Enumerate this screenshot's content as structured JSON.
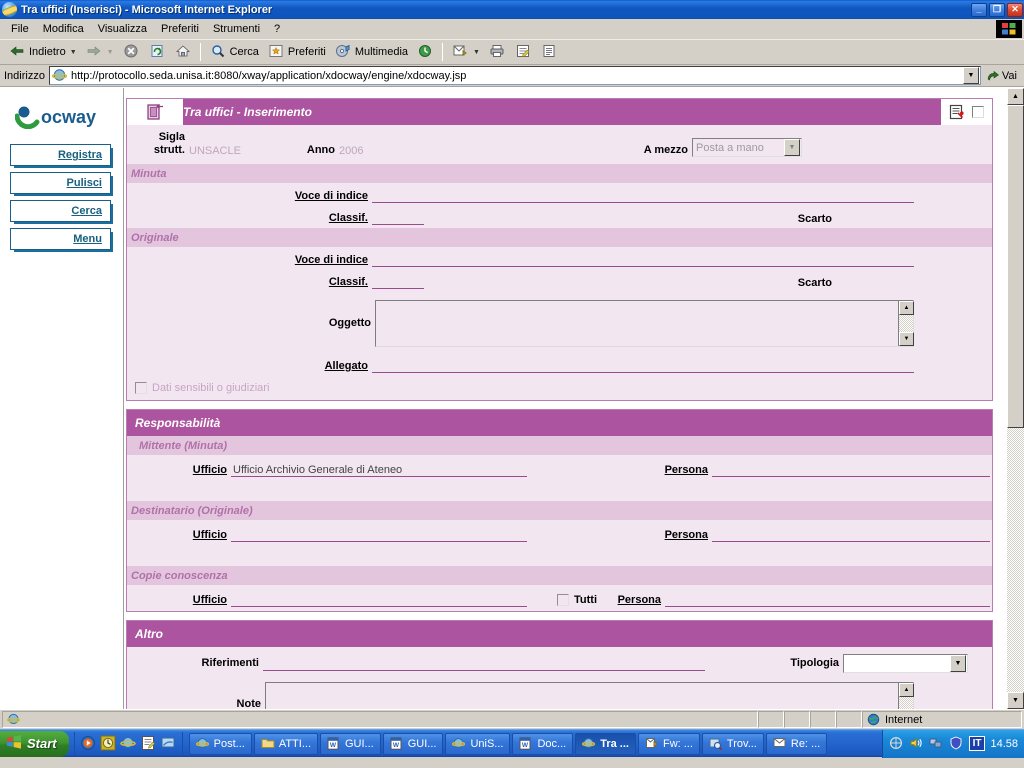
{
  "window": {
    "title": "Tra uffici (Inserisci) - Microsoft Internet Explorer",
    "minimize": "_",
    "restore": "❐",
    "close": "✕"
  },
  "menu": {
    "items": [
      {
        "label": "File"
      },
      {
        "label": "Modifica"
      },
      {
        "label": "Visualizza"
      },
      {
        "label": "Preferiti"
      },
      {
        "label": "Strumenti"
      },
      {
        "label": "?"
      }
    ]
  },
  "toolbar": {
    "back": "Indietro",
    "forward": "",
    "stop": "",
    "refresh": "",
    "home": "",
    "search": "Cerca",
    "favorites": "Preferiti",
    "media": "Multimedia",
    "history": "",
    "mail": "",
    "print": "",
    "edit": "",
    "discuss": ""
  },
  "address": {
    "label": "Indirizzo",
    "url": "http://protocollo.seda.unisa.it:8080/xway/application/xdocway/engine/xdocway.jsp",
    "go": "Vai"
  },
  "sidebar": {
    "logo_text": "ocway",
    "buttons": [
      {
        "label": "Registra"
      },
      {
        "label": "Pulisci"
      },
      {
        "label": "Cerca"
      },
      {
        "label": "Menu"
      }
    ]
  },
  "form": {
    "header": {
      "title": "Tra uffici - Inserimento"
    },
    "top": {
      "sigla_label": "Sigla strutt.",
      "sigla_value": "UNSACLE",
      "anno_label": "Anno",
      "anno_value": "2006",
      "mezzo_label": "A mezzo",
      "mezzo_value": "Posta a mano"
    },
    "minuta": {
      "section": "Minuta",
      "voce_label": "Voce di indice",
      "voce_value": "",
      "classif_label": "Classif.",
      "classif_value": "",
      "scarto_label": "Scarto"
    },
    "originale": {
      "section": "Originale",
      "voce_label": "Voce di indice",
      "voce_value": "",
      "classif_label": "Classif.",
      "classif_value": "",
      "scarto_label": "Scarto"
    },
    "oggetto": {
      "label": "Oggetto",
      "value": ""
    },
    "allegato": {
      "label": "Allegato",
      "value": ""
    },
    "dati_sensibili": {
      "label": "Dati sensibili o giudiziari",
      "checked": false
    },
    "responsabilita": {
      "section": "Responsabilità",
      "mittente": {
        "section": "Mittente (Minuta)",
        "ufficio_label": "Ufficio",
        "ufficio_value": "Ufficio Archivio Generale di Ateneo",
        "persona_label": "Persona",
        "persona_value": ""
      },
      "destinatario": {
        "section": "Destinatario (Originale)",
        "ufficio_label": "Ufficio",
        "ufficio_value": "",
        "persona_label": "Persona",
        "persona_value": ""
      },
      "copie": {
        "section": "Copie conoscenza",
        "ufficio_label": "Ufficio",
        "ufficio_value": "",
        "tutti_label": "Tutti",
        "tutti_checked": false,
        "persona_label": "Persona",
        "persona_value": ""
      }
    },
    "altro": {
      "section": "Altro",
      "riferimenti_label": "Riferimenti",
      "riferimenti_value": "",
      "tipologia_label": "Tipologia",
      "tipologia_value": "",
      "note_label": "Note",
      "note_value": ""
    }
  },
  "statusbar": {
    "zone": "Internet"
  },
  "taskbar": {
    "start": "Start",
    "tasks": [
      {
        "label": "Post...",
        "icon": "ie-icon",
        "active": false
      },
      {
        "label": "ATTI...",
        "icon": "folder-icon",
        "active": false
      },
      {
        "label": "GUI...",
        "icon": "word-icon",
        "active": false
      },
      {
        "label": "GUI...",
        "icon": "word-icon",
        "active": false
      },
      {
        "label": "UniS...",
        "icon": "ie-icon",
        "active": false
      },
      {
        "label": "Doc...",
        "icon": "word-icon",
        "active": false
      },
      {
        "label": "Tra ...",
        "icon": "ie-icon",
        "active": true
      },
      {
        "label": "Fw: ...",
        "icon": "mail-icon",
        "active": false
      },
      {
        "label": "Trov...",
        "icon": "search-icon",
        "active": false
      },
      {
        "label": "Re: ...",
        "icon": "mail-icon",
        "active": false
      }
    ],
    "tray": {
      "language": "IT",
      "clock": "14.58"
    }
  }
}
